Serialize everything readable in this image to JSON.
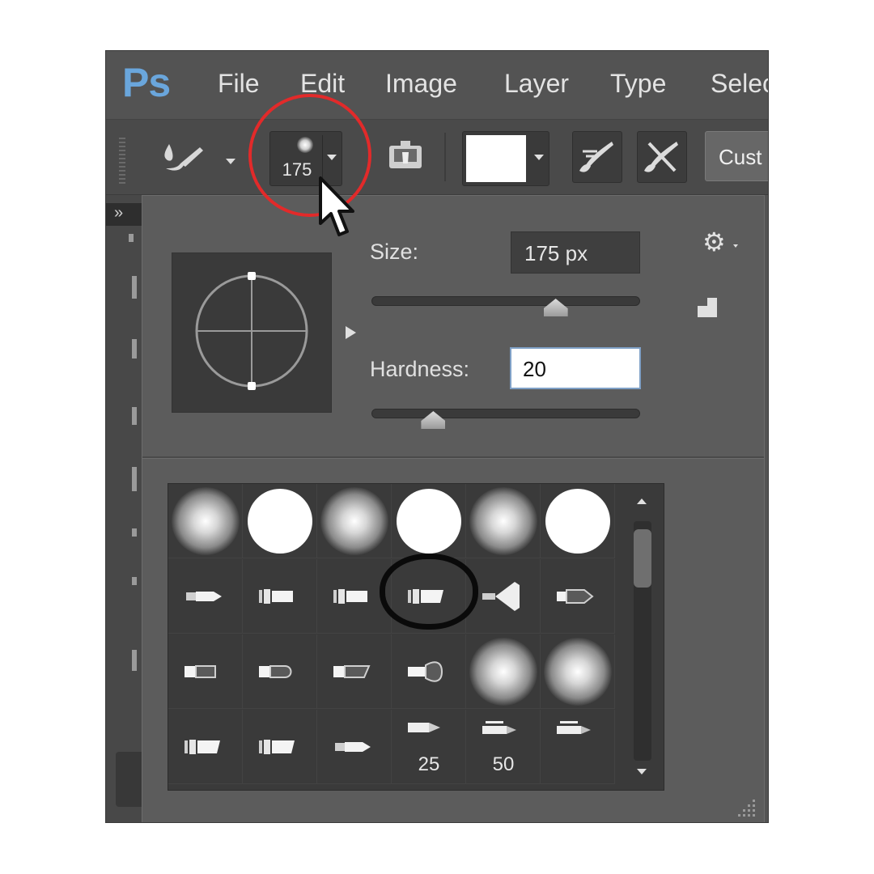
{
  "app": {
    "logo": "Ps"
  },
  "menu": {
    "items": [
      "File",
      "Edit",
      "Image",
      "Layer",
      "Type",
      "Selec"
    ]
  },
  "options_bar": {
    "brush_size": "175",
    "custom_label": "Cust",
    "swatch_color": "#ffffff"
  },
  "panel": {
    "size_label": "Size:",
    "size_value": "175 px",
    "size_slider": {
      "min": 1,
      "max": 5000,
      "value": 175
    },
    "hardness_label": "Hardness:",
    "hardness_value": "20",
    "hardness_slider": {
      "min": 0,
      "max": 100,
      "value": 20
    }
  },
  "brush_presets": {
    "rows": [
      [
        "soft-round",
        "hard-round",
        "soft-round",
        "hard-round",
        "soft-round",
        "hard-round"
      ],
      [
        "round-point-brush",
        "flat-bristle-brush",
        "flat-bristle-brush",
        "flat-angle-brush",
        "fan-brush",
        "round-blunt-brush"
      ],
      [
        "flat-blunt-brush",
        "round-curve-brush",
        "angle-brush",
        "round-fan-brush",
        "soft-round",
        "soft-round"
      ],
      [
        "flat-angle-brush",
        "flat-angle-brush",
        "round-point-brush",
        "airbrush-tip",
        "pen-tip",
        "pen-tip"
      ]
    ],
    "labels": {
      "3.3": "25",
      "3.4": "50"
    }
  },
  "colors": {
    "annotation_red": "#e22a2a",
    "annotation_black": "#0a0a0a",
    "logo_blue": "#6aa6dc"
  }
}
